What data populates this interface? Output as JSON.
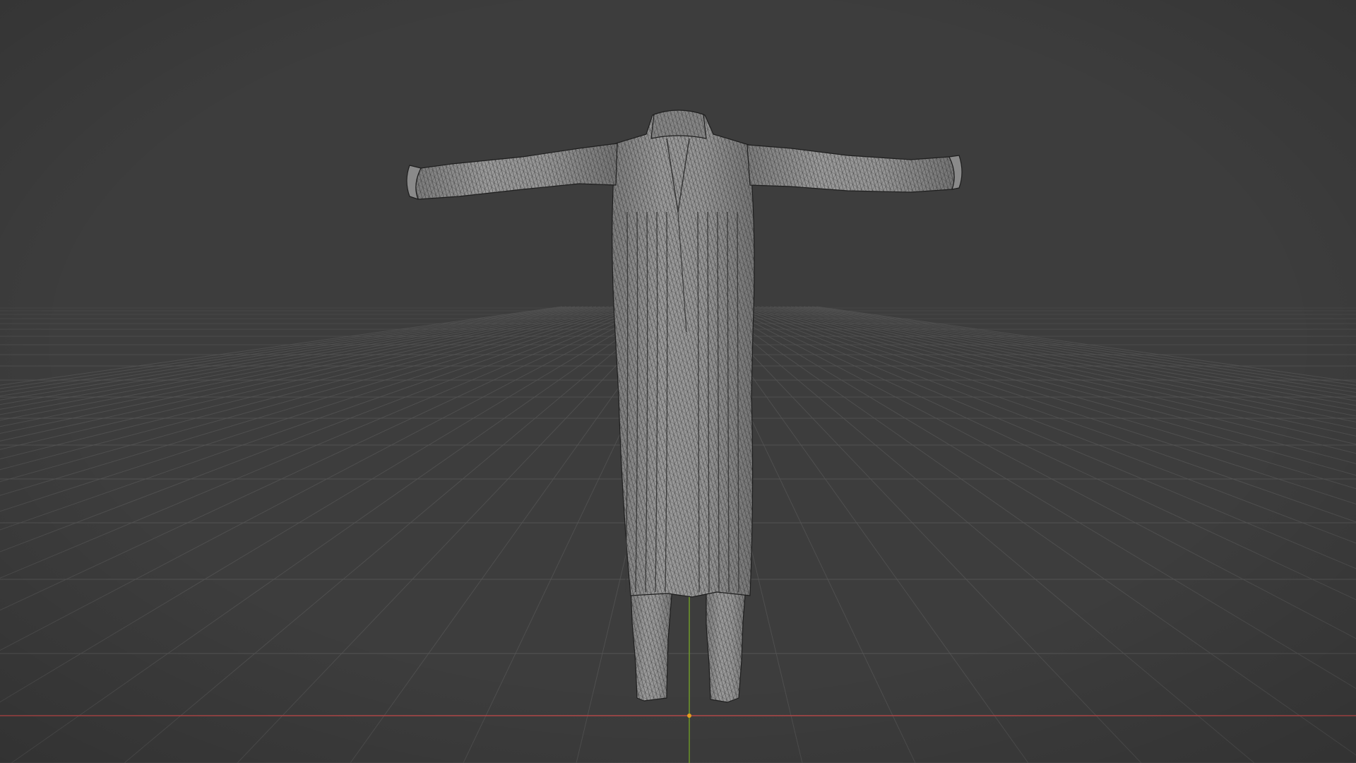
{
  "viewport": {
    "background_color": "#3d3d3d",
    "grid_line_color": "#555555",
    "x_axis_color": "#b34a4a",
    "y_axis_color": "#6f9a2a",
    "origin_color": "#e8a020",
    "grid_visible": true,
    "shading_mode": "solid-wireframe"
  },
  "scene_object": {
    "kind": "garment mesh",
    "description_icon": "mesh-icon",
    "surface_color": "#8e8e8e",
    "wire_color": "#2c2c2c"
  }
}
